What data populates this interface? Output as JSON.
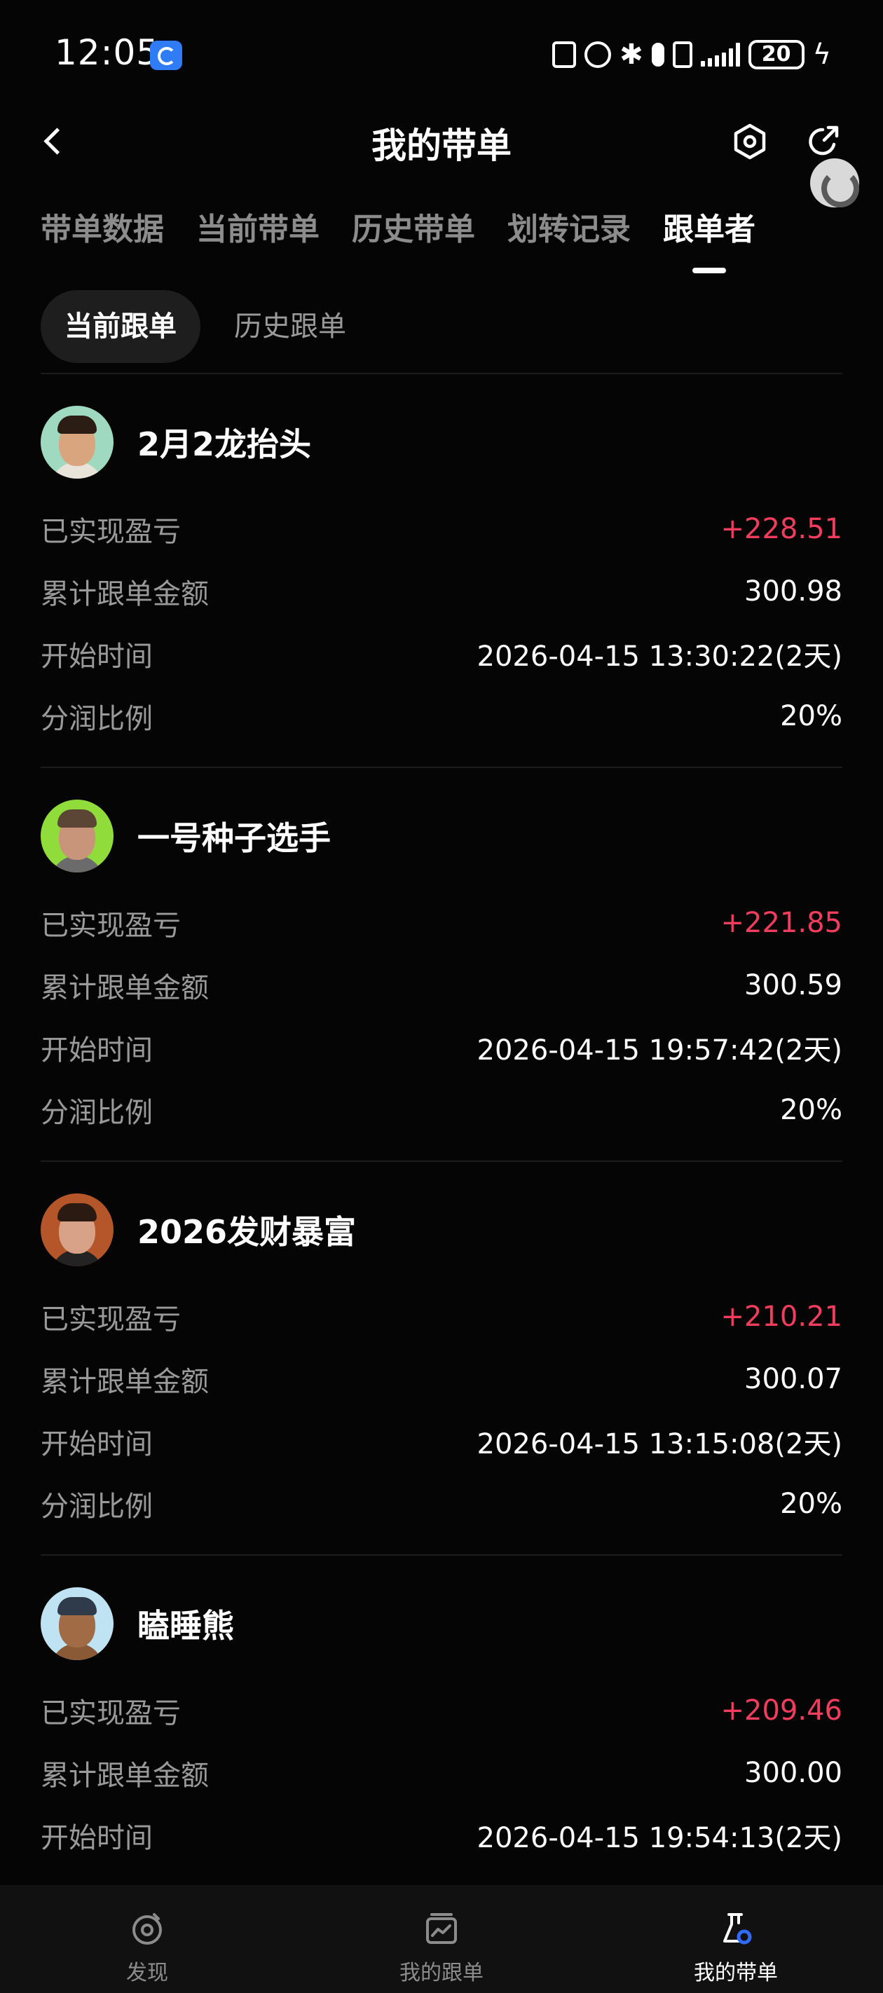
{
  "status_bar": {
    "time": "12:05",
    "battery": "20"
  },
  "header": {
    "title": "我的带单"
  },
  "tabs": [
    {
      "label": "带单数据",
      "active": false
    },
    {
      "label": "当前带单",
      "active": false
    },
    {
      "label": "历史带单",
      "active": false
    },
    {
      "label": "划转记录",
      "active": false
    },
    {
      "label": "跟单者",
      "active": true
    }
  ],
  "subtabs": [
    {
      "label": "当前跟单",
      "active": true
    },
    {
      "label": "历史跟单",
      "active": false
    }
  ],
  "field_labels": {
    "pnl": "已实现盈亏",
    "amount": "累计跟单金额",
    "start": "开始时间",
    "share": "分润比例"
  },
  "followers": [
    {
      "name": "2月2龙抬头",
      "pnl": "+228.51",
      "amount": "300.98",
      "start": "2026-04-15 13:30:22(2天)",
      "share": "20%",
      "avatar_bg": "#9fd9c0",
      "avatar_skin": "#d9a57f",
      "avatar_hair": "#2b1d14",
      "avatar_shirt": "#e9e4da"
    },
    {
      "name": "一号种子选手",
      "pnl": "+221.85",
      "amount": "300.59",
      "start": "2026-04-15 19:57:42(2天)",
      "share": "20%",
      "avatar_bg": "#8fdc3a",
      "avatar_skin": "#c9957a",
      "avatar_hair": "#5b4636",
      "avatar_shirt": "#6b6b6b"
    },
    {
      "name": "2026发财暴富",
      "pnl": "+210.21",
      "amount": "300.07",
      "start": "2026-04-15 13:15:08(2天)",
      "share": "20%",
      "avatar_bg": "#b4562a",
      "avatar_skin": "#d7a287",
      "avatar_hair": "#2a1a12",
      "avatar_shirt": "#232323"
    },
    {
      "name": "瞌睡熊",
      "pnl": "+209.46",
      "amount": "300.00",
      "start": "2026-04-15 19:54:13(2天)",
      "share": "",
      "avatar_bg": "#bfe3f2",
      "avatar_skin": "#a06b45",
      "avatar_hair": "#2f3b4a",
      "avatar_shirt": "#8a5a36"
    }
  ],
  "bottom_nav": [
    {
      "label": "发现",
      "icon": "discover-icon",
      "active": false
    },
    {
      "label": "我的跟单",
      "icon": "chart-card-icon",
      "active": false
    },
    {
      "label": "我的带单",
      "icon": "flask-icon",
      "active": true
    }
  ],
  "colors": {
    "background": "#050505",
    "profit": "#f23d5e",
    "muted": "#9a9a9a",
    "accent_blue": "#2f6bff"
  }
}
